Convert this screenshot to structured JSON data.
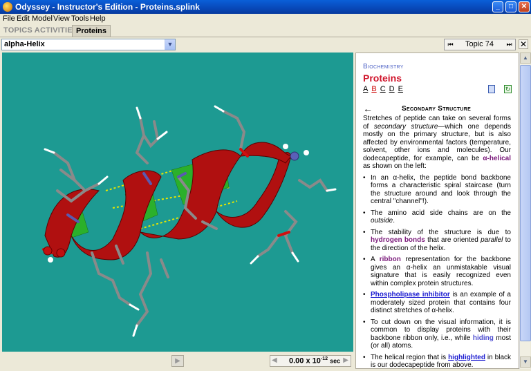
{
  "window": {
    "title": "Odyssey - Instructor's Edition - Proteins.splink",
    "buttons": {
      "minimize": "_",
      "maximize": "□",
      "close": "✕"
    }
  },
  "menu": [
    "File",
    "Edit",
    "Model",
    "View",
    "Tools",
    "Help"
  ],
  "tabs": {
    "topics_activities": "TOPICS ACTIVITIES",
    "proteins": "Proteins"
  },
  "toolbar": {
    "model_select": "alpha-Helix",
    "topic_label": "Topic 74",
    "first_glyph": "⏮",
    "next_glyph": "⏭",
    "close_glyph": "✕"
  },
  "bottom": {
    "play_glyph": "▶",
    "rewind_glyph": "◀",
    "time_value": "0.00 x 10",
    "time_exponent": "-12",
    "time_unit": "sec",
    "forward_glyph": "▶"
  },
  "panel": {
    "category": "Biochemistry",
    "title": "Proteins",
    "letters": [
      "A",
      "B",
      "C",
      "D",
      "E"
    ],
    "active_letter": "B",
    "section_title": "Secondary Structure",
    "back_glyph": "←",
    "intro_1": "Stretches of peptide can take on several forms of ",
    "intro_em": "secondary structure",
    "intro_2": "—which one depends mostly on the primary structure, but is also affected by environmental factors (temperature, solvent, other ions and molecules). Our dodecapeptide, for example, can be ",
    "intro_kw": "α-helical",
    "intro_3": " as shown on the left:",
    "b1": "In an α-helix, the peptide bond backbone forms a characteristic spiral staircase (turn the structure around and look through the central \"channel\"!).",
    "b2_1": "The amino acid side chains are on the ",
    "b2_em": "outside",
    "b2_2": ".",
    "b3_1": "The stability of the structure is due to ",
    "b3_kw": "hydrogen bonds",
    "b3_2": " that are oriented ",
    "b3_em": "parallel",
    "b3_3": " to the direction of the helix.",
    "b4_1": "A ",
    "b4_kw": "ribbon",
    "b4_2": " representation for the backbone gives an α-helix an unmistakable visual signature that is easily recognized even within complex protein structures.",
    "b5_link": "Phospholipase inhibitor",
    "b5_2": " is an example of a moderately sized protein that contains four distinct stretches of α-helix.",
    "b6_1": "To cut down on the visual information, it is common to display proteins with their backbone ribbon only, i.e., while ",
    "b6_kw": "hiding",
    "b6_2": " most (or all) atoms.",
    "b7_1": "The helical region that is ",
    "b7_link": "highlighted",
    "b7_2": " in black is our dodecapeptide from above."
  }
}
